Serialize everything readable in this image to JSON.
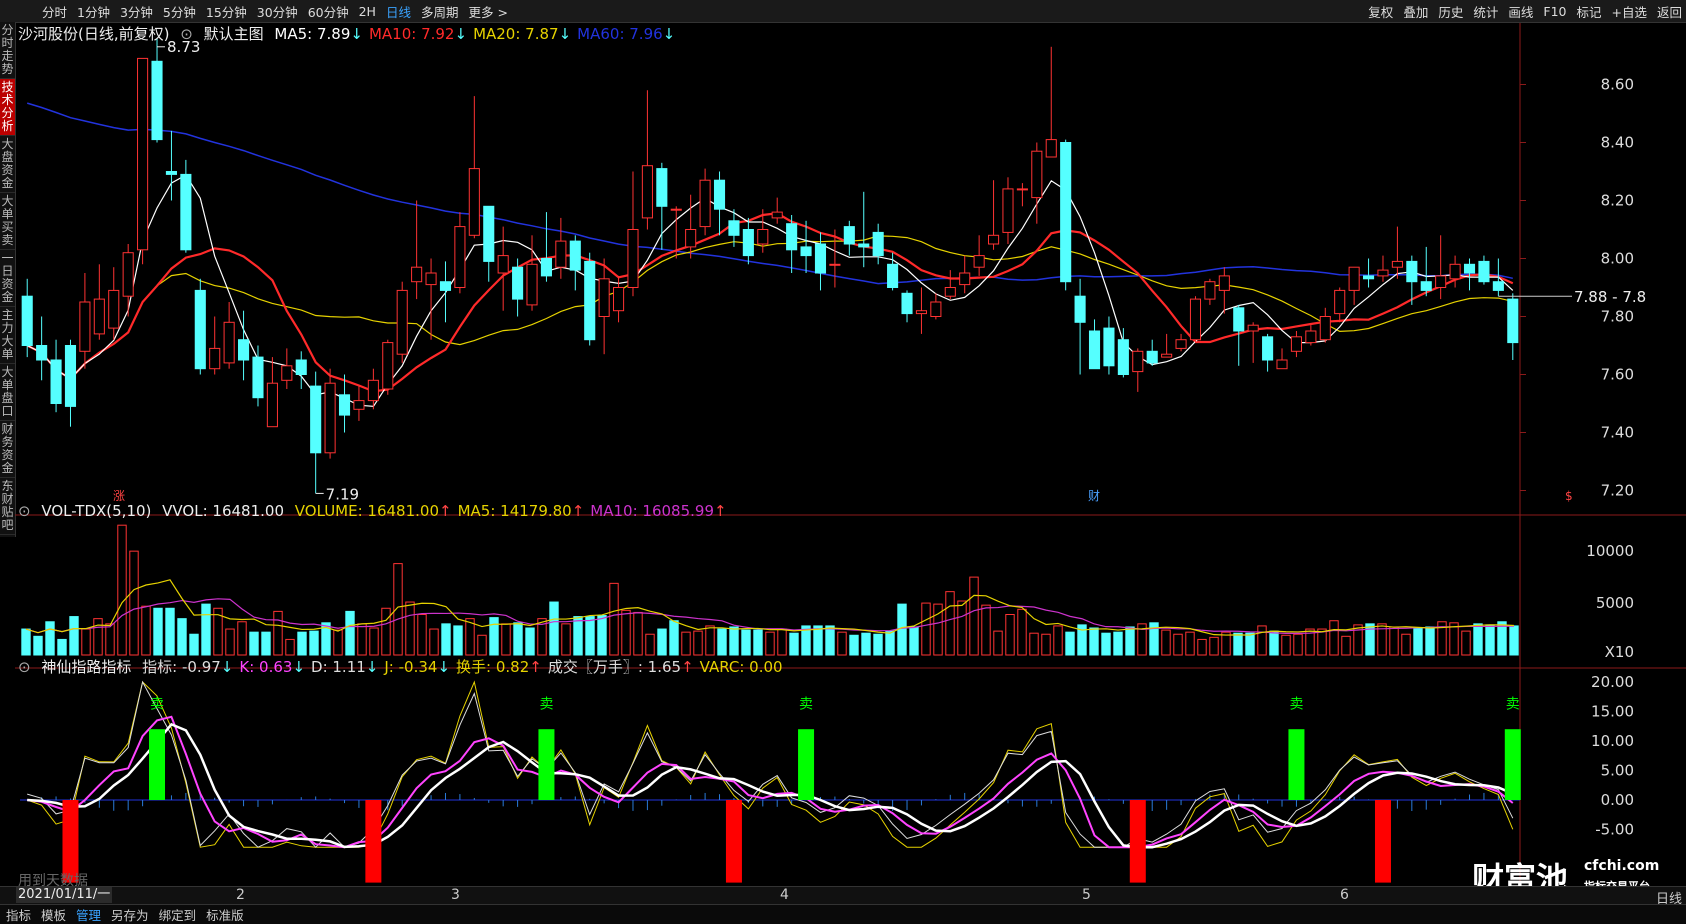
{
  "toolbar": {
    "periods": [
      {
        "label": "分时",
        "active": false
      },
      {
        "label": "1分钟",
        "active": false
      },
      {
        "label": "3分钟",
        "active": false
      },
      {
        "label": "5分钟",
        "active": false
      },
      {
        "label": "15分钟",
        "active": false
      },
      {
        "label": "30分钟",
        "active": false
      },
      {
        "label": "60分钟",
        "active": false
      },
      {
        "label": "2H",
        "active": false
      },
      {
        "label": "日线",
        "active": true
      },
      {
        "label": "多周期",
        "active": false
      },
      {
        "label": "更多 >",
        "active": false
      }
    ],
    "tools": [
      "复权",
      "叠加",
      "历史",
      "统计",
      "画线",
      "F10",
      "标记",
      "+自选",
      "返回"
    ]
  },
  "side_tabs": [
    {
      "label": "分时走势",
      "active": false
    },
    {
      "label": "技术分析",
      "active": true
    },
    {
      "label": "大盘资金",
      "active": false
    },
    {
      "label": "大单买卖",
      "active": false
    },
    {
      "label": "一日资金",
      "active": false
    },
    {
      "label": "主力大单",
      "active": false
    },
    {
      "label": "大单盘口",
      "active": false
    },
    {
      "label": "财务资金",
      "active": false
    },
    {
      "label": "东财贴吧",
      "active": false
    }
  ],
  "main_panel": {
    "title": "沙河股份(日线,前复权)",
    "template": "默认主图",
    "ma": [
      {
        "label": "MA5: 7.89",
        "arrow": "↓",
        "color": "#ffffff"
      },
      {
        "label": "MA10: 7.92",
        "arrow": "↓",
        "color": "#ff2a2a"
      },
      {
        "label": "MA20: 7.87",
        "arrow": "↓",
        "color": "#e6d200"
      },
      {
        "label": "MA60: 7.96",
        "arrow": "↓",
        "color": "#2233dd"
      }
    ],
    "high_label": "8.73",
    "low_label": "7.19",
    "current_label": "7.88 - 7.8",
    "y_ticks": [
      "8.60",
      "8.40",
      "8.20",
      "8.00",
      "7.80",
      "7.60",
      "7.40",
      "7.20"
    ],
    "markers": [
      {
        "text": "涨",
        "color": "#ff4444"
      },
      {
        "text": "财",
        "color": "#4aa0ff"
      },
      {
        "text": "$",
        "color": "#ff4444"
      }
    ]
  },
  "volume_panel": {
    "name": "VOL-TDX(5,10)",
    "vvol": "VVOL: 16481.00",
    "items": [
      {
        "label": "VOLUME: 16481.00",
        "color": "#e6d200"
      },
      {
        "label": "MA5: 14179.80",
        "color": "#e6d200"
      },
      {
        "label": "MA10: 16085.99",
        "color": "#cc33cc"
      }
    ],
    "y_ticks": [
      "10000",
      "5000"
    ],
    "unit": "X10"
  },
  "indicator_panel": {
    "name": "神仙指路指标",
    "items": [
      {
        "label": "指标: -0.97",
        "arrow": "↓",
        "color": "#dddddd"
      },
      {
        "label": "K: 0.63",
        "arrow": "↓",
        "color": "#ff44ff"
      },
      {
        "label": "D: 1.11",
        "arrow": "↓",
        "color": "#dddddd"
      },
      {
        "label": "J: -0.34",
        "arrow": "↓",
        "color": "#e6d200"
      },
      {
        "label": "换手: 0.82",
        "arrow": "↑",
        "color": "#e6d200"
      },
      {
        "label": "成交〖万手〗: 1.65",
        "arrow": "↑",
        "color": "#dddddd"
      },
      {
        "label": "VARC: 0.00",
        "arrow": "",
        "color": "#e6d200"
      }
    ],
    "y_ticks": [
      "20.00",
      "15.00",
      "10.00",
      "5.00",
      "0.00",
      "-5.00"
    ],
    "sell_label": "卖"
  },
  "x_axis": {
    "date": "2021/01/11/一",
    "months": [
      "2",
      "3",
      "4",
      "5",
      "6"
    ],
    "right_button": "日线"
  },
  "bottom_bar": [
    {
      "label": "指标",
      "active": false
    },
    {
      "label": "模板",
      "active": false
    },
    {
      "label": "管理",
      "active": true
    },
    {
      "label": "另存为",
      "active": false
    },
    {
      "label": "绑定到",
      "active": false
    },
    {
      "label": "标准版",
      "active": false
    }
  ],
  "watermark": {
    "hint": "用到天数据",
    "brand": "财富池",
    "site": "cfchi.com",
    "slogan": "指标交易平台"
  },
  "colors": {
    "up": "#ff3333",
    "down": "#55ffff",
    "ma5": "#ffffff",
    "ma10": "#ff2a2a",
    "ma20": "#e6d200",
    "ma60": "#2233dd",
    "buy": "#ff0000",
    "sell": "#00ff00"
  },
  "chart_data": [
    {
      "type": "candlestick",
      "title": "沙河股份(日线,前复权)",
      "ylim": [
        7.15,
        8.75
      ],
      "y_ticks": [
        8.6,
        8.4,
        8.2,
        8.0,
        7.8,
        7.6,
        7.4,
        7.2
      ],
      "candles": [
        [
          7.87,
          7.7,
          7.93,
          7.66
        ],
        [
          7.7,
          7.65,
          7.8,
          7.58
        ],
        [
          7.65,
          7.5,
          7.72,
          7.47
        ],
        [
          7.7,
          7.49,
          7.72,
          7.42
        ],
        [
          7.68,
          7.85,
          7.95,
          7.62
        ],
        [
          7.74,
          7.86,
          7.98,
          7.72
        ],
        [
          7.76,
          7.89,
          7.97,
          7.72
        ],
        [
          7.87,
          8.02,
          8.05,
          7.8
        ],
        [
          8.03,
          8.69,
          8.69,
          7.98
        ],
        [
          8.68,
          8.41,
          8.76,
          8.4
        ],
        [
          8.3,
          8.29,
          8.44,
          8.2
        ],
        [
          8.29,
          8.03,
          8.34,
          8.02
        ],
        [
          7.89,
          7.62,
          7.93,
          7.6
        ],
        [
          7.62,
          7.69,
          7.8,
          7.6
        ],
        [
          7.64,
          7.78,
          7.85,
          7.62
        ],
        [
          7.72,
          7.65,
          7.82,
          7.58
        ],
        [
          7.66,
          7.52,
          7.7,
          7.49
        ],
        [
          7.42,
          7.57,
          7.66,
          7.42
        ],
        [
          7.58,
          7.63,
          7.69,
          7.55
        ],
        [
          7.65,
          7.6,
          7.68,
          7.55
        ],
        [
          7.56,
          7.33,
          7.61,
          7.19
        ],
        [
          7.33,
          7.57,
          7.62,
          7.31
        ],
        [
          7.53,
          7.46,
          7.6,
          7.4
        ],
        [
          7.48,
          7.51,
          7.56,
          7.44
        ],
        [
          7.51,
          7.58,
          7.62,
          7.48
        ],
        [
          7.55,
          7.71,
          7.72,
          7.53
        ],
        [
          7.67,
          7.89,
          7.92,
          7.64
        ],
        [
          7.92,
          7.97,
          8.2,
          7.86
        ],
        [
          7.91,
          7.95,
          8.0,
          7.72
        ],
        [
          7.92,
          7.89,
          7.99,
          7.78
        ],
        [
          7.9,
          8.11,
          8.16,
          7.88
        ],
        [
          8.08,
          8.31,
          8.56,
          8.07
        ],
        [
          8.18,
          7.99,
          8.18,
          7.92
        ],
        [
          7.95,
          8.01,
          8.11,
          7.82
        ],
        [
          7.97,
          7.86,
          8.0,
          7.8
        ],
        [
          7.84,
          7.98,
          8.08,
          7.82
        ],
        [
          8.0,
          7.94,
          8.16,
          7.92
        ],
        [
          7.97,
          8.06,
          8.14,
          7.93
        ],
        [
          8.06,
          7.96,
          8.08,
          7.89
        ],
        [
          7.99,
          7.72,
          8.02,
          7.7
        ],
        [
          7.8,
          7.93,
          8.0,
          7.67
        ],
        [
          7.82,
          7.9,
          7.94,
          7.78
        ],
        [
          7.9,
          8.1,
          8.3,
          7.87
        ],
        [
          8.14,
          8.32,
          8.58,
          8.1
        ],
        [
          8.31,
          8.18,
          8.33,
          8.03
        ],
        [
          8.17,
          8.17,
          8.18,
          8.0
        ],
        [
          8.04,
          8.1,
          8.22,
          8.0
        ],
        [
          8.11,
          8.27,
          8.31,
          8.08
        ],
        [
          8.27,
          8.17,
          8.3,
          8.08
        ],
        [
          8.13,
          8.08,
          8.17,
          8.04
        ],
        [
          8.1,
          8.01,
          8.14,
          7.98
        ],
        [
          8.05,
          8.1,
          8.17,
          8.02
        ],
        [
          8.14,
          8.16,
          8.21,
          8.12
        ],
        [
          8.12,
          8.03,
          8.15,
          7.95
        ],
        [
          8.04,
          8.01,
          8.13,
          7.95
        ],
        [
          8.05,
          7.95,
          8.09,
          7.89
        ],
        [
          7.98,
          7.98,
          8.1,
          7.9
        ],
        [
          8.11,
          8.05,
          8.13,
          8.01
        ],
        [
          8.05,
          8.04,
          8.23,
          7.97
        ],
        [
          8.09,
          8.01,
          8.12,
          7.98
        ],
        [
          7.98,
          7.9,
          8.02,
          7.89
        ],
        [
          7.88,
          7.81,
          7.89,
          7.78
        ],
        [
          7.81,
          7.82,
          7.9,
          7.74
        ],
        [
          7.8,
          7.85,
          7.88,
          7.79
        ],
        [
          7.87,
          7.9,
          7.96,
          7.86
        ],
        [
          7.91,
          7.95,
          8.01,
          7.88
        ],
        [
          7.97,
          8.01,
          8.08,
          7.94
        ],
        [
          8.05,
          8.08,
          8.27,
          8.03
        ],
        [
          8.09,
          8.24,
          8.28,
          8.05
        ],
        [
          8.24,
          8.24,
          8.26,
          8.18
        ],
        [
          8.21,
          8.37,
          8.4,
          8.12
        ],
        [
          8.35,
          8.41,
          8.73,
          8.35
        ],
        [
          8.4,
          7.92,
          8.41,
          7.89
        ],
        [
          7.87,
          7.78,
          7.93,
          7.6
        ],
        [
          7.75,
          7.62,
          7.79,
          7.62
        ],
        [
          7.76,
          7.63,
          7.8,
          7.6
        ],
        [
          7.72,
          7.6,
          7.76,
          7.59
        ],
        [
          7.61,
          7.68,
          7.69,
          7.54
        ],
        [
          7.68,
          7.64,
          7.72,
          7.63
        ],
        [
          7.66,
          7.67,
          7.74,
          7.66
        ],
        [
          7.69,
          7.72,
          7.74,
          7.68
        ],
        [
          7.72,
          7.86,
          7.87,
          7.71
        ],
        [
          7.86,
          7.92,
          7.93,
          7.84
        ],
        [
          7.89,
          7.94,
          7.97,
          7.81
        ],
        [
          7.83,
          7.75,
          7.84,
          7.63
        ],
        [
          7.75,
          7.77,
          7.78,
          7.64
        ],
        [
          7.73,
          7.65,
          7.74,
          7.61
        ],
        [
          7.62,
          7.65,
          7.69,
          7.62
        ],
        [
          7.68,
          7.73,
          7.75,
          7.66
        ],
        [
          7.71,
          7.75,
          7.77,
          7.7
        ],
        [
          7.72,
          7.8,
          7.83,
          7.71
        ],
        [
          7.81,
          7.89,
          7.9,
          7.78
        ],
        [
          7.89,
          7.97,
          7.97,
          7.84
        ],
        [
          7.94,
          7.93,
          8.0,
          7.9
        ],
        [
          7.94,
          7.96,
          8.01,
          7.92
        ],
        [
          7.97,
          7.99,
          8.11,
          7.93
        ],
        [
          7.99,
          7.92,
          8.01,
          7.84
        ],
        [
          7.92,
          7.89,
          8.04,
          7.87
        ],
        [
          7.9,
          7.94,
          8.08,
          7.86
        ],
        [
          7.93,
          7.98,
          8.01,
          7.9
        ],
        [
          7.98,
          7.95,
          8.0,
          7.89
        ],
        [
          7.99,
          7.92,
          8.01,
          7.91
        ],
        [
          7.92,
          7.89,
          8.0,
          7.87
        ],
        [
          7.86,
          7.71,
          7.88,
          7.65
        ]
      ],
      "ma5_last": 7.89,
      "ma10_last": 7.92,
      "ma20_last": 7.87,
      "ma60_last": 7.96
    },
    {
      "type": "bar",
      "title": "VOL-TDX(5,10)",
      "ylim": [
        0,
        13000
      ],
      "values": [
        2500,
        1800,
        3200,
        1500,
        3700,
        2500,
        3500,
        3000,
        12500,
        10000,
        4700,
        4500,
        4500,
        3500,
        2000,
        4900,
        4500,
        2500,
        3200,
        2200,
        2200,
        4200,
        1500,
        2200,
        2300,
        3100,
        2400,
        4200,
        3000,
        2600,
        4500,
        8800,
        5100,
        3900,
        2500,
        3000,
        2800,
        3500,
        1900,
        3600,
        3000,
        3100,
        2600,
        3500,
        5100,
        3000,
        3700,
        3700,
        3800,
        6900,
        4300,
        4100,
        2000,
        2500,
        3300,
        2200,
        2300,
        2800,
        2500,
        2700,
        2400,
        2400,
        2200,
        2500,
        2100,
        2800,
        2800,
        2800,
        2200,
        1900,
        2100,
        2000,
        2300,
        4900,
        2700,
        5000,
        4900,
        6100,
        5200,
        7500,
        4800,
        2300,
        3900,
        4400,
        2100,
        2000,
        2800,
        2200,
        2900,
        2600,
        2100,
        2200,
        2700,
        3000,
        3100,
        2400,
        2000,
        2200,
        1500,
        1700,
        2200,
        2100,
        2100,
        2800,
        2300,
        1900,
        2000,
        2500,
        2500,
        3300,
        1800,
        2900,
        3000,
        3000,
        2700,
        2000,
        2600,
        2700,
        3200,
        3100,
        2300,
        3000,
        2900,
        3200,
        2800
      ]
    },
    {
      "type": "bar",
      "title": "神仙指路指标",
      "ylim": [
        -8,
        22
      ],
      "y_ticks": [
        20,
        15,
        10,
        5,
        0,
        -5
      ],
      "sell_signals": 5,
      "buy_signals": 5
    }
  ]
}
